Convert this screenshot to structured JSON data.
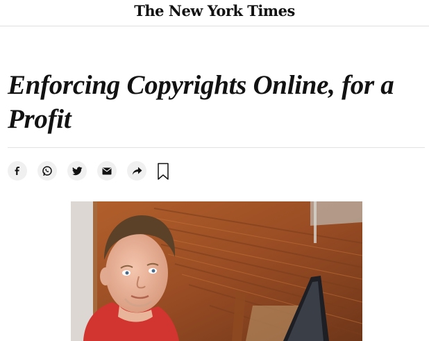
{
  "masthead": {
    "logo_text": "The New York Times"
  },
  "article": {
    "headline": "Enforcing Copyrights Online, for a Profit"
  },
  "share": {
    "buttons": [
      {
        "icon": "facebook-icon"
      },
      {
        "icon": "whatsapp-icon"
      },
      {
        "icon": "twitter-icon"
      },
      {
        "icon": "email-icon"
      },
      {
        "icon": "share-arrow-icon"
      }
    ],
    "bookmark_icon": "bookmark-icon"
  },
  "photo": {
    "subject": "young-man-with-laptop"
  },
  "colors": {
    "text": "#121212",
    "divider": "#e2e2e2",
    "button_bg": "#f0f0f0",
    "wood_floor": "#a0562a",
    "shirt": "#d2342f"
  }
}
